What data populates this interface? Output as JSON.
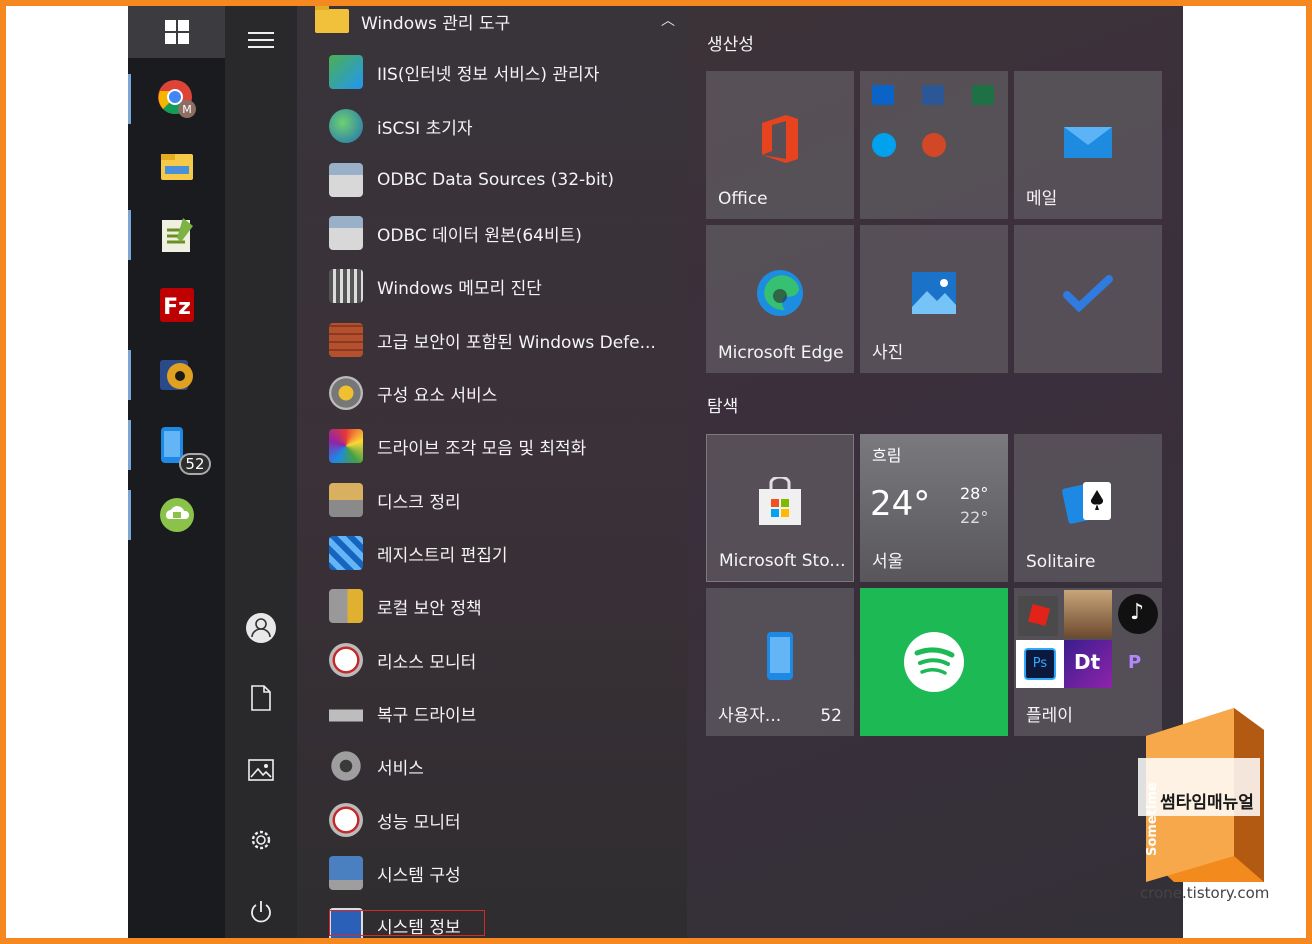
{
  "taskbar": {
    "items": [
      {
        "name": "chrome",
        "label": ""
      },
      {
        "name": "file-explorer",
        "label": ""
      },
      {
        "name": "notepad-plus",
        "label": ""
      },
      {
        "name": "filezilla",
        "label": ""
      },
      {
        "name": "media-player",
        "label": ""
      },
      {
        "name": "phone-link",
        "badge": "52"
      },
      {
        "name": "cloud-app",
        "label": ""
      }
    ]
  },
  "app_list": {
    "folder": "Windows 관리 도구",
    "items": [
      "IIS(인터넷 정보 서비스) 관리자",
      "iSCSI 초기자",
      "ODBC Data Sources (32-bit)",
      "ODBC 데이터 원본(64비트)",
      "Windows 메모리 진단",
      "고급 보안이 포함된 Windows Defe...",
      "구성 요소 서비스",
      "드라이브 조각 모음 및 최적화",
      "디스크 정리",
      "레지스트리 편집기",
      "로컬 보안 정책",
      "리소스 모니터",
      "복구 드라이브",
      "서비스",
      "성능 모니터",
      "시스템 구성",
      "시스템 정보"
    ]
  },
  "tiles": {
    "group1": "생산성",
    "group2": "탐색",
    "office": "Office",
    "mail": "메일",
    "edge": "Microsoft Edge",
    "photos": "사진",
    "store": "Microsoft Sto...",
    "weather_cond": "흐림",
    "weather_temp": "24°",
    "weather_high": "28°",
    "weather_low": "22°",
    "weather_city": "서울",
    "solitaire": "Solitaire",
    "phone": "사용자...",
    "phone_count": "52",
    "play": "플레이"
  },
  "watermark": {
    "brand": "썸타임매뉴얼",
    "url": "crone.tistory.com",
    "logo_text": "Sometime"
  },
  "colors": {
    "accent_border": "#f5891f",
    "spotify": "#1db954",
    "selection": "#d42a2a"
  }
}
